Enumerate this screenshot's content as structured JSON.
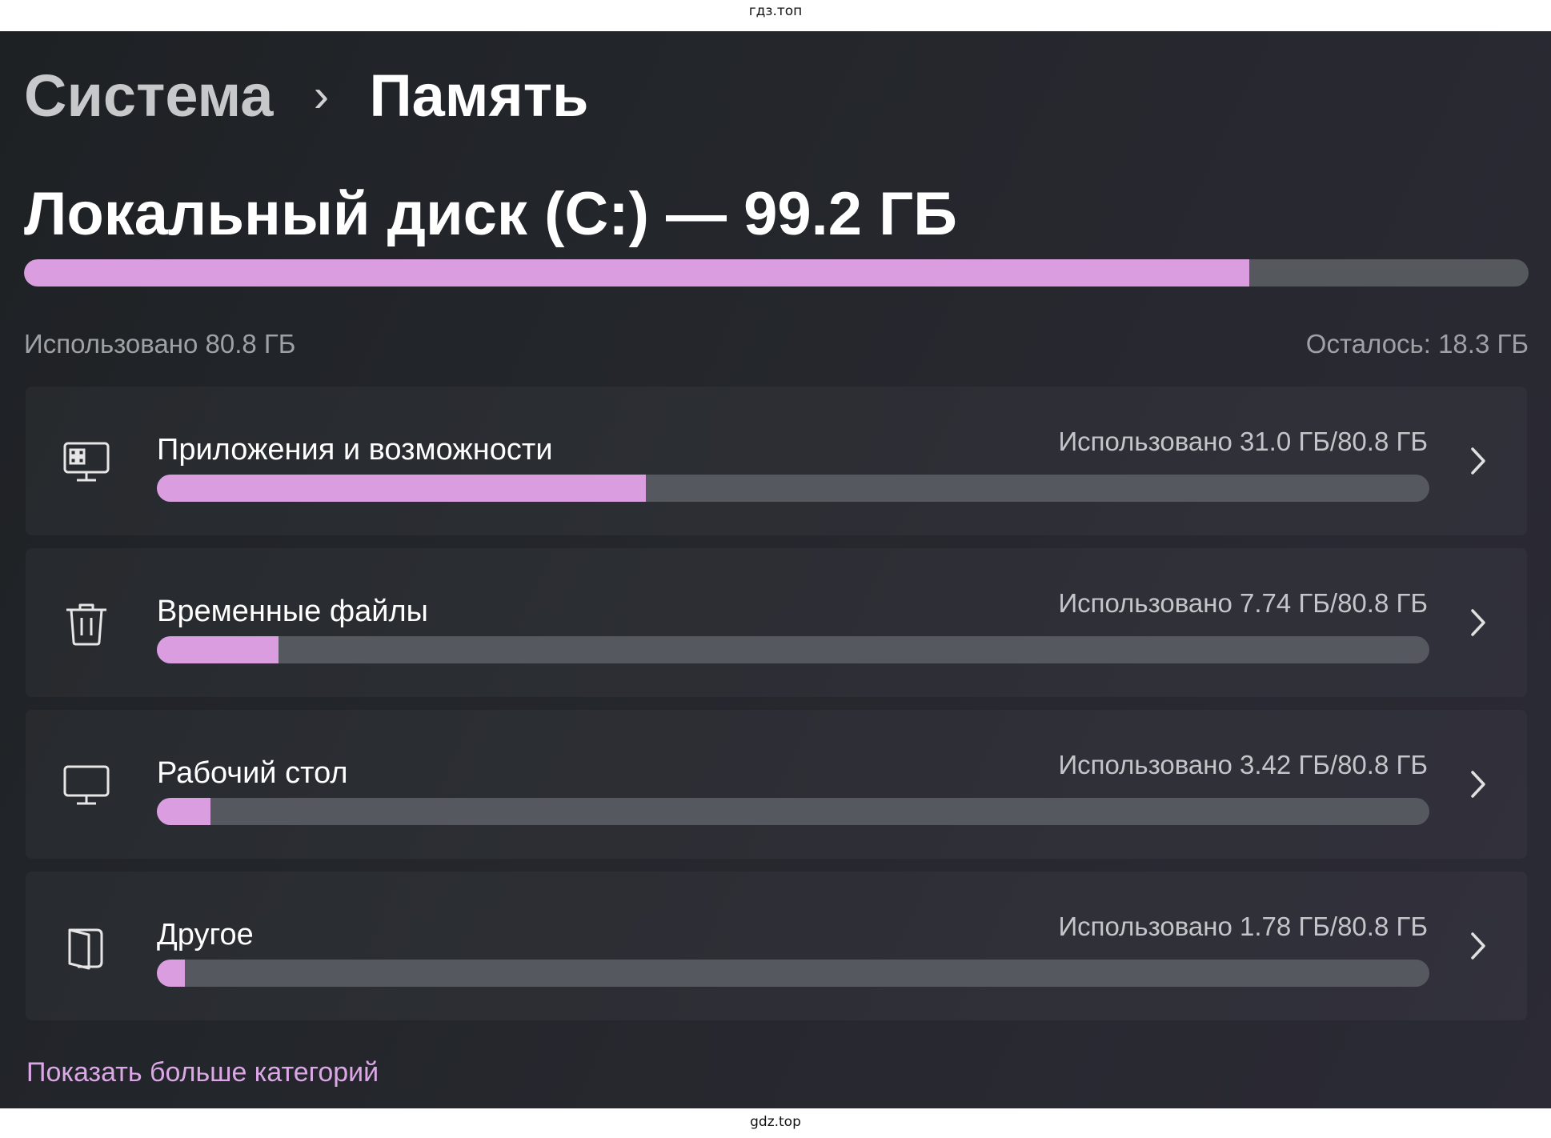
{
  "watermark_top": "гдз.топ",
  "watermark_bottom": "gdz.top",
  "breadcrumb": {
    "parent": "Система",
    "separator": "›",
    "current": "Память"
  },
  "disk": {
    "title": "Локальный диск (C:) — 99.2 ГБ",
    "used_label": "Использовано 80.8 ГБ",
    "free_label": "Осталось: 18.3 ГБ",
    "used_fraction": 0.8145
  },
  "categories": [
    {
      "icon": "apps-icon",
      "name": "Приложения и возможности",
      "usage": "Использовано 31.0 ГБ/80.8 ГБ",
      "fraction": 0.384
    },
    {
      "icon": "trash-icon",
      "name": "Временные файлы",
      "usage": "Использовано 7.74 ГБ/80.8 ГБ",
      "fraction": 0.0958
    },
    {
      "icon": "monitor-icon",
      "name": "Рабочий стол",
      "usage": "Использовано 3.42 ГБ/80.8 ГБ",
      "fraction": 0.0423
    },
    {
      "icon": "document-icon",
      "name": "Другое",
      "usage": "Использовано 1.78 ГБ/80.8 ГБ",
      "fraction": 0.022
    }
  ],
  "more_link": "Показать больше категорий",
  "colors": {
    "accent": "#d99de0",
    "track": "#55585e",
    "link": "#dca7e6"
  }
}
